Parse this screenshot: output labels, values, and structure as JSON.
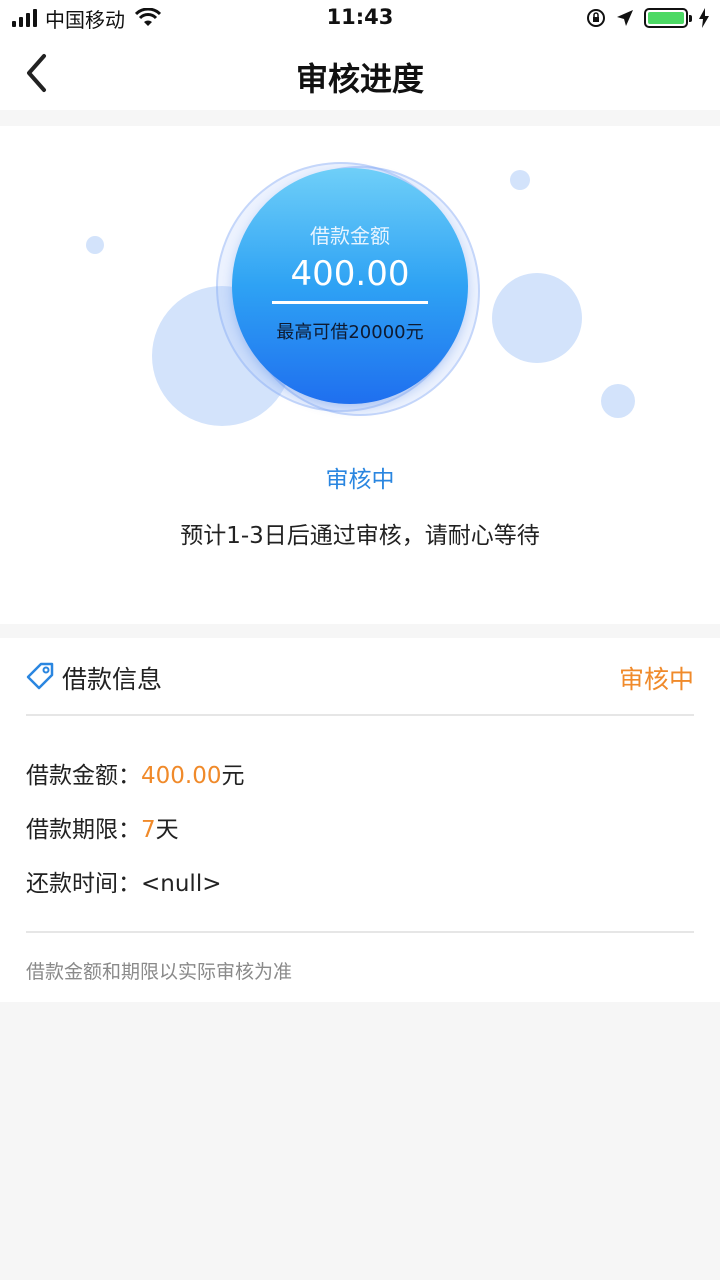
{
  "status_bar": {
    "carrier": "中国移动",
    "time": "11:43",
    "battery_color": "#4cd964"
  },
  "nav": {
    "title": "审核进度",
    "back_icon": "chevron-left-icon"
  },
  "progress": {
    "amount_label": "借款金额",
    "amount": "400.00",
    "max_text": "最高可借20000元",
    "status": "审核中",
    "hint": "预计1-3日后通过审核，请耐心等待"
  },
  "loan_info": {
    "title": "借款信息",
    "status": "审核中",
    "amount_label": "借款金额：",
    "amount_value": "400.00",
    "amount_unit": "元",
    "term_label": "借款期限：",
    "term_value": "7",
    "term_unit": "天",
    "repay_label": "还款时间：",
    "repay_value": "<null>",
    "footer_note": "借款金额和期限以实际审核为准"
  },
  "colors": {
    "accent_orange": "#f08a2a",
    "accent_blue": "#2a86e0"
  }
}
